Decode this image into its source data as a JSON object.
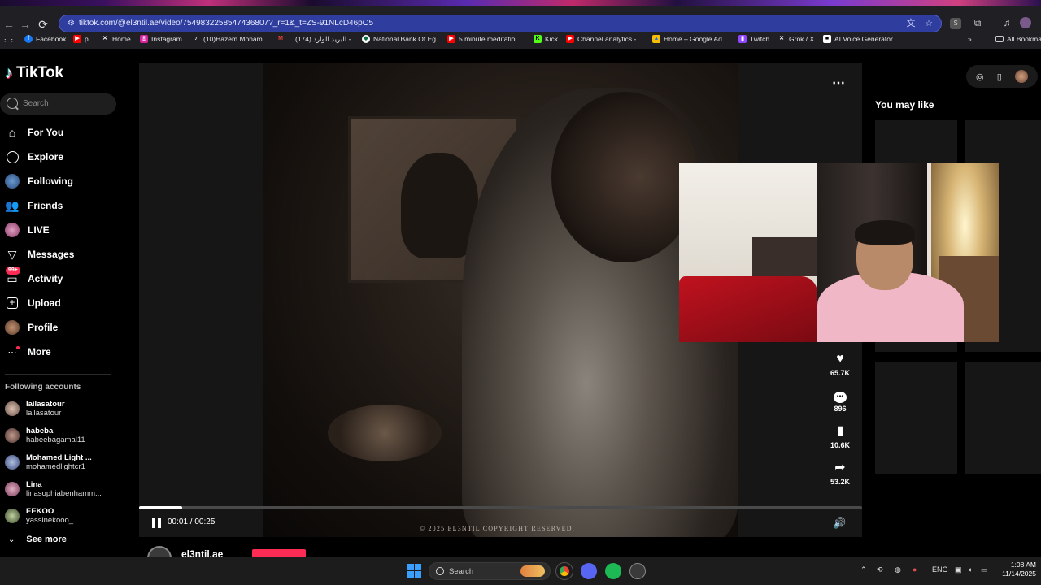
{
  "browser": {
    "url": "tiktok.com/@el3ntil.ae/video/7549832258547436807?_r=1&_t=ZS-91NLcD46pO5",
    "bookmarks": [
      {
        "label": "Facebook",
        "icon": "facebook-icon",
        "color": "#1877f2"
      },
      {
        "label": "p",
        "icon": "youtube-icon",
        "color": "#ff0000"
      },
      {
        "label": "Home",
        "icon": "x-icon",
        "color": "#000000"
      },
      {
        "label": "Instagram",
        "icon": "instagram-icon",
        "color": "#d6249f"
      },
      {
        "label": "(10)Hazem Moham...",
        "icon": "tiktok-icon",
        "color": "#000000"
      },
      {
        "label": "",
        "icon": "gmail-icon",
        "color": "#ea4335"
      },
      {
        "label": "(174) البريد الوارد - ...",
        "icon": "gmail-icon",
        "color": "#ea4335"
      },
      {
        "label": "National Bank Of Eg...",
        "icon": "bank-icon",
        "color": "#0a6e3c"
      },
      {
        "label": "5 minute meditatio...",
        "icon": "youtube-icon",
        "color": "#ff0000"
      },
      {
        "label": "Kick",
        "icon": "kick-icon",
        "color": "#53fc18"
      },
      {
        "label": "Channel analytics -...",
        "icon": "youtube-studio-icon",
        "color": "#ff0000"
      },
      {
        "label": "Home – Google Ad...",
        "icon": "google-ads-icon",
        "color": "#fbbc04"
      },
      {
        "label": "Twitch",
        "icon": "twitch-icon",
        "color": "#9146ff"
      },
      {
        "label": "Grok / X",
        "icon": "x-icon",
        "color": "#000000"
      },
      {
        "label": "AI Voice Generator...",
        "icon": "ai-voice-icon",
        "color": "#ffffff"
      }
    ],
    "all_bookmarks": "All Bookma"
  },
  "tiktok": {
    "logo": "TikTok",
    "search_placeholder": "Search",
    "nav": [
      {
        "label": "For You",
        "icon": "home-icon"
      },
      {
        "label": "Explore",
        "icon": "compass-icon"
      },
      {
        "label": "Following",
        "icon": "following-avatar-icon"
      },
      {
        "label": "Friends",
        "icon": "friends-icon"
      },
      {
        "label": "LIVE",
        "icon": "live-avatar-icon"
      },
      {
        "label": "Messages",
        "icon": "messages-icon"
      },
      {
        "label": "Activity",
        "icon": "activity-icon",
        "badge": "99+"
      },
      {
        "label": "Upload",
        "icon": "upload-icon"
      },
      {
        "label": "Profile",
        "icon": "profile-avatar-icon"
      },
      {
        "label": "More",
        "icon": "more-icon"
      }
    ],
    "following_heading": "Following accounts",
    "following": [
      {
        "name": "lailasatour",
        "handle": "lailasatour"
      },
      {
        "name": "habeba",
        "handle": "habeebagamal11"
      },
      {
        "name": "Mohamed Light ...",
        "handle": "mohamedlightcr1"
      },
      {
        "name": "Lina",
        "handle": "linasophiabenhamm..."
      },
      {
        "name": "EEKOO",
        "handle": "yassinekooo_"
      }
    ],
    "see_more": "See more",
    "video": {
      "copyright": "© 2025 EL3NTIL COPYRIGHT RESERVED.",
      "time": "00:01 / 00:25",
      "progress": 0.06,
      "author_partial": "el3ntil.ae"
    },
    "actions": [
      {
        "icon": "heart-icon",
        "count": "65.7K"
      },
      {
        "icon": "comment-icon",
        "count": "896"
      },
      {
        "icon": "bookmark-icon",
        "count": "10.6K"
      },
      {
        "icon": "share-icon",
        "count": "53.2K"
      }
    ],
    "you_may_like": "You may like"
  },
  "taskbar": {
    "search_placeholder": "Search",
    "lang": "ENG",
    "time": "1:08 AM",
    "date": "11/14/2025"
  }
}
